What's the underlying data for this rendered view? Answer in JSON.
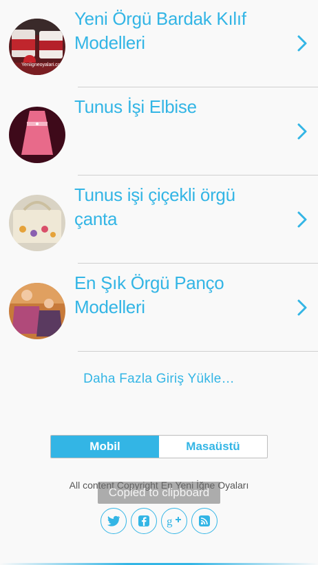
{
  "items": [
    {
      "title": "Yeni Örgü Bardak Kılıf Modelleri",
      "thumb_caption": "Yeniigneoyalari.com"
    },
    {
      "title": "Tunus İşi Elbise"
    },
    {
      "title": "Tunus işi çiçekli örgü çanta"
    },
    {
      "title": "En Şık Örgü Panço Modelleri"
    }
  ],
  "load_more": "Daha Fazla Giriş Yükle…",
  "view_switch": {
    "mobile": "Mobil",
    "desktop": "Masaüstü",
    "selected": "Mobil"
  },
  "footer": {
    "copyright": "All content Copyright En Yeni İğne Oyaları",
    "toast": "Copied to clipboard",
    "social": [
      "twitter-icon",
      "facebook-icon",
      "google-plus-icon",
      "rss-icon"
    ]
  },
  "colors": {
    "accent": "#33b5e5",
    "background": "#f9f9f9",
    "divider": "#cfcfcf"
  }
}
